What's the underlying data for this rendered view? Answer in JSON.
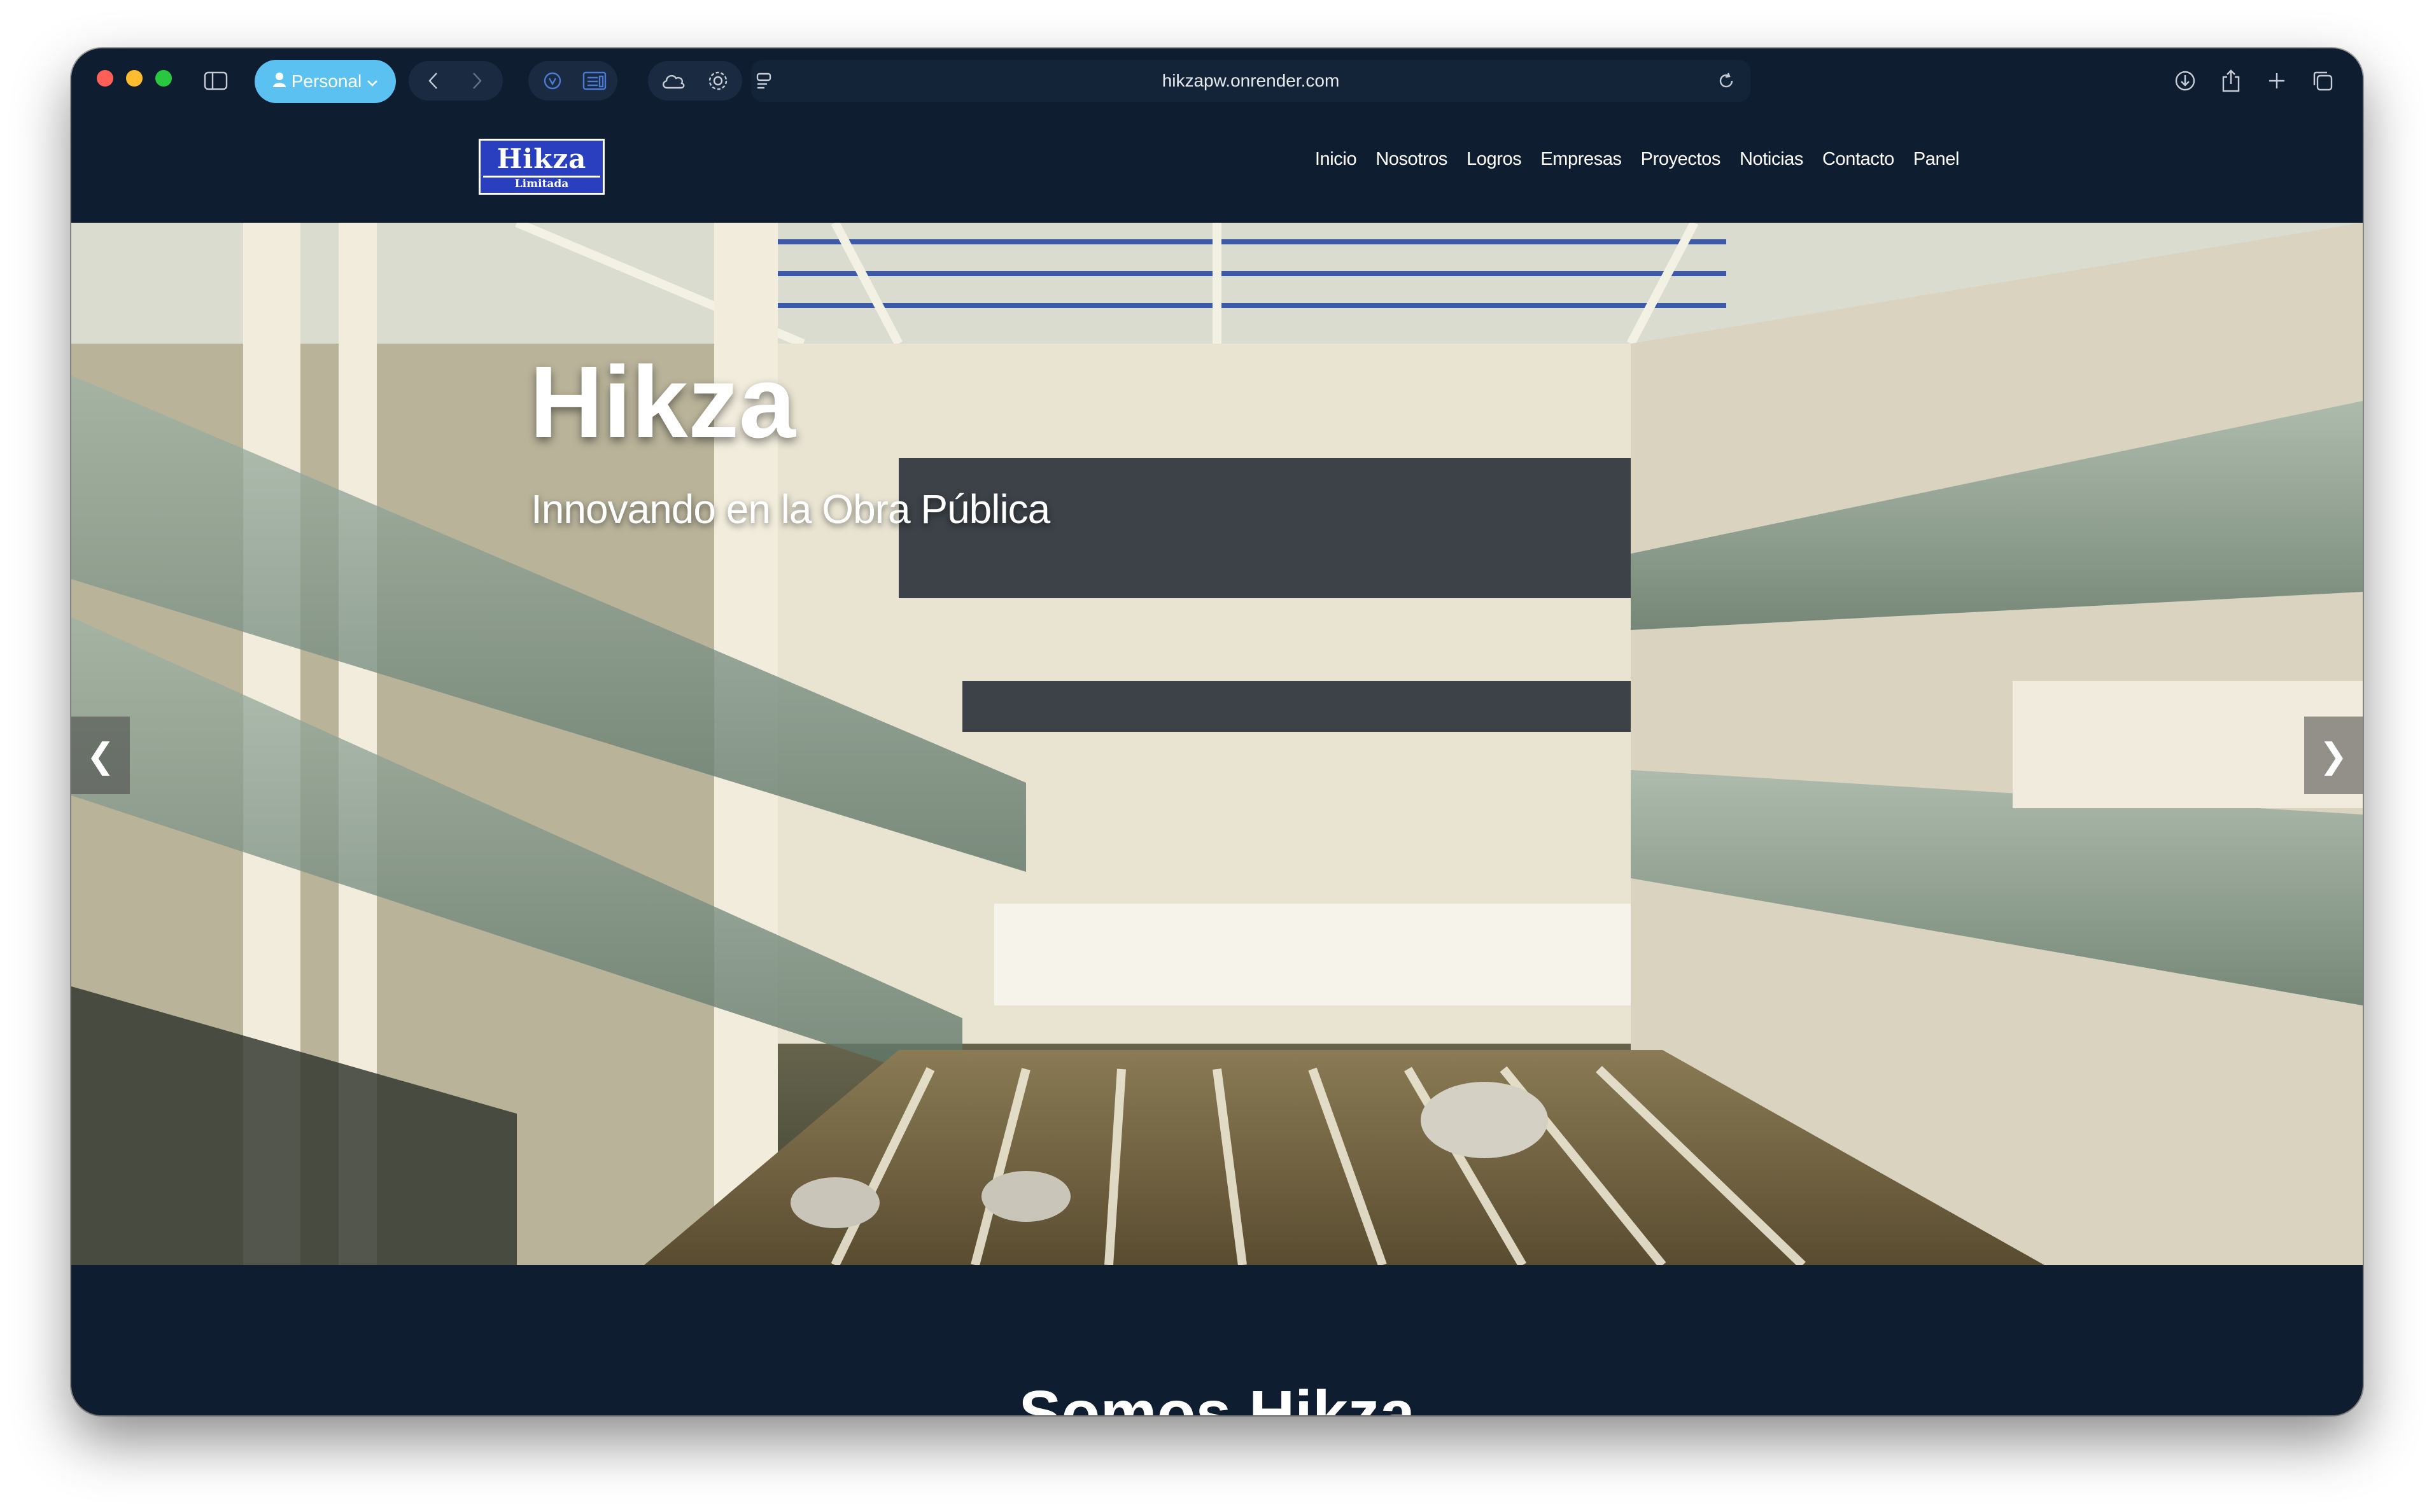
{
  "browser": {
    "profile_label": "Personal",
    "url": "hikzapw.onrender.com"
  },
  "site": {
    "logo_line1": "Hikza",
    "logo_line2": "Limitada",
    "nav": [
      "Inicio",
      "Nosotros",
      "Logros",
      "Empresas",
      "Proyectos",
      "Noticias",
      "Contacto",
      "Panel"
    ]
  },
  "hero": {
    "title": "Hikza",
    "subtitle": "Innovando en la Obra Pública",
    "prev_arrow": "❮",
    "next_arrow": "❯"
  },
  "section": {
    "title": "Somos Hikza"
  },
  "colors": {
    "page_bg": "#0f1d31",
    "profile_accent": "#5ac1f0",
    "logo_blue": "#2a3fc0"
  }
}
